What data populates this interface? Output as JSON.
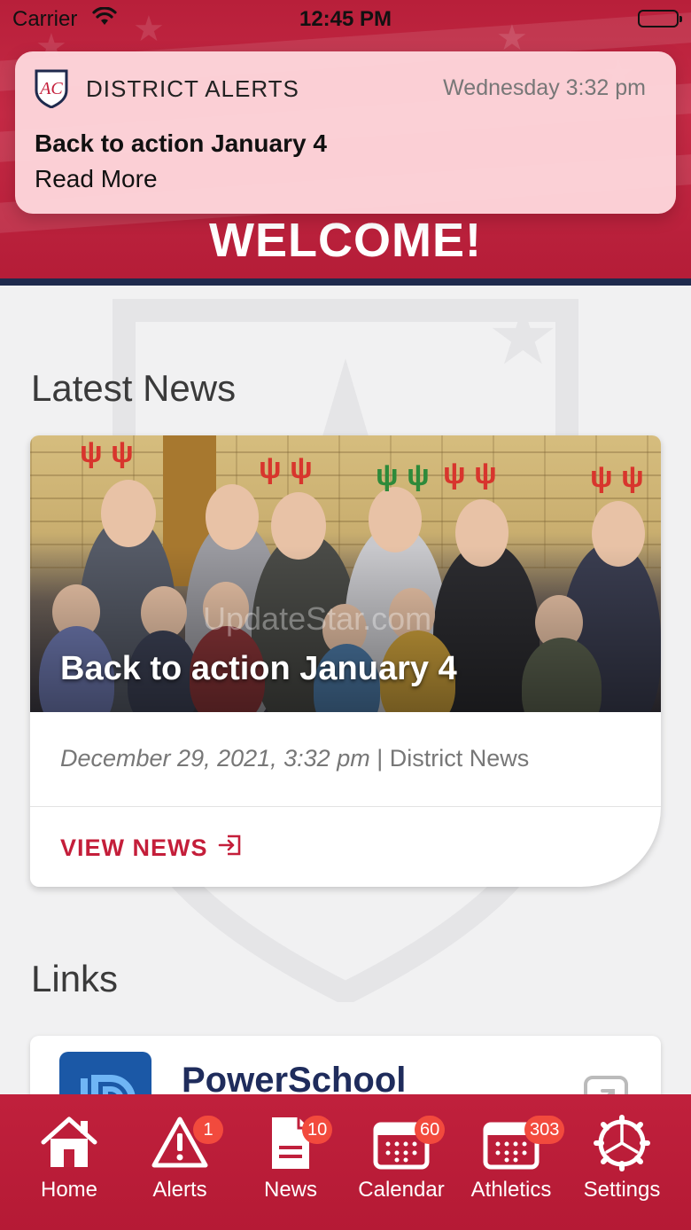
{
  "status_bar": {
    "carrier": "Carrier",
    "time": "12:45 PM"
  },
  "header": {
    "welcome": "WELCOME!"
  },
  "notification": {
    "app_name": "DISTRICT ALERTS",
    "time": "Wednesday 3:32 pm",
    "title": "Back to action January 4",
    "body": "Read More"
  },
  "latest_news": {
    "heading": "Latest News",
    "card": {
      "title": "Back to action January 4",
      "watermark": "UpdateStar.com",
      "date": "December 29, 2021, 3:32 pm",
      "separator": " | ",
      "category": "District News",
      "action": "VIEW NEWS"
    }
  },
  "links": {
    "heading": "Links",
    "items": [
      {
        "title": "PowerSchool"
      }
    ]
  },
  "tabbar": {
    "tabs": [
      {
        "label": "Home",
        "badge": "",
        "icon": "home-icon"
      },
      {
        "label": "Alerts",
        "badge": "1",
        "icon": "alert-icon"
      },
      {
        "label": "News",
        "badge": "10",
        "icon": "news-icon"
      },
      {
        "label": "Calendar",
        "badge": "60",
        "icon": "calendar-icon"
      },
      {
        "label": "Athletics",
        "badge": "303",
        "icon": "athletics-calendar-icon"
      },
      {
        "label": "Settings",
        "badge": "",
        "icon": "settings-icon"
      }
    ]
  },
  "colors": {
    "brand_red": "#c41e3a",
    "navy": "#1f2a4d",
    "badge_red": "#f24a3d",
    "notification_bg": "#fdd6dc"
  }
}
